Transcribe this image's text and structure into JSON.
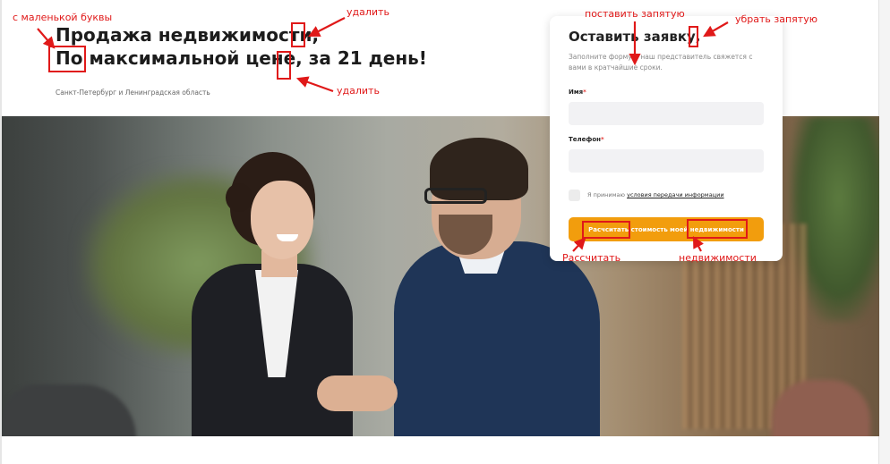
{
  "hero": {
    "title_line1": "Продажа недвижимости,",
    "title_line2": "По максимальной цене, за 21 день!",
    "subtitle": "Санкт-Петербург и Ленинградская область"
  },
  "form": {
    "title": "Оставить заявку,",
    "description": "Заполните форму и наш представитель свяжется с вами в кратчайшие сроки.",
    "name_label": "Имя",
    "phone_label": "Телефон",
    "required_mark": "*",
    "consent_text": "Я принимаю",
    "consent_link": "условия передачи информации",
    "submit_label": "Расчситать стоимость моей нeдвижимости"
  },
  "annotations": {
    "lowercase": "с маленькой буквы",
    "delete_top": "удалить",
    "delete_bottom": "удалить",
    "add_comma": "поставить запятую",
    "remove_comma": "убрать запятую",
    "correct_calc": "Рассчитать",
    "correct_property": "недвижимости"
  },
  "colors": {
    "accent": "#f29d0d",
    "annotation": "#e01919"
  }
}
